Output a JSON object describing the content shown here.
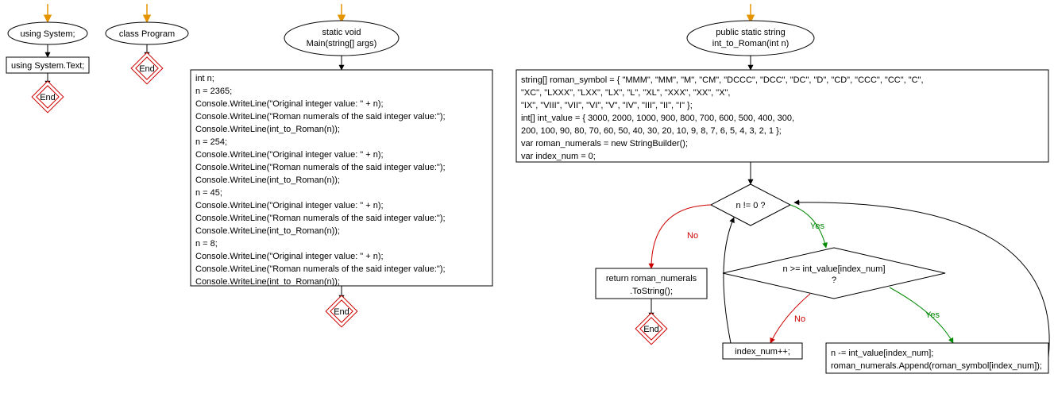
{
  "nodes": {
    "n1_ellipse": "using System;",
    "n1_rect": "using System.Text;",
    "n1_end": "End",
    "n2_ellipse": "class Program",
    "n2_end": "End",
    "n3_ellipse_l1": "static void",
    "n3_ellipse_l2": "Main(string[] args)",
    "n3_rect": [
      "int n;",
      "n = 2365;",
      "Console.WriteLine(\"Original integer value: \" + n);",
      "Console.WriteLine(\"Roman numerals of the said integer value:\");",
      "Console.WriteLine(int_to_Roman(n));",
      "n = 254;",
      "Console.WriteLine(\"Original integer value: \" + n);",
      "Console.WriteLine(\"Roman numerals of the said integer value:\");",
      "Console.WriteLine(int_to_Roman(n));",
      "n = 45;",
      "Console.WriteLine(\"Original integer value: \" + n);",
      "Console.WriteLine(\"Roman numerals of the said integer value:\");",
      "Console.WriteLine(int_to_Roman(n));",
      "n = 8;",
      "Console.WriteLine(\"Original integer value: \" + n);",
      "Console.WriteLine(\"Roman numerals of the said integer value:\");",
      "Console.WriteLine(int_to_Roman(n));"
    ],
    "n3_end": "End",
    "n4_ellipse_l1": "public static string",
    "n4_ellipse_l2": "int_to_Roman(int n)",
    "n4_rect": [
      "string[] roman_symbol = { \"MMM\", \"MM\", \"M\", \"CM\", \"DCCC\", \"DCC\", \"DC\", \"D\", \"CD\", \"CCC\", \"CC\", \"C\",",
      "\"XC\", \"LXXX\", \"LXX\", \"LX\", \"L\", \"XL\", \"XXX\", \"XX\", \"X\",",
      "\"IX\", \"VIII\", \"VII\", \"VI\", \"V\", \"IV\", \"III\", \"II\", \"I\" };",
      "int[] int_value = { 3000, 2000, 1000, 900, 800, 700, 600, 500, 400, 300,",
      "200, 100, 90, 80, 70, 60, 50, 40, 30, 20, 10, 9, 8, 7, 6, 5, 4, 3, 2, 1 };",
      "var roman_numerals = new StringBuilder();",
      "var index_num = 0;"
    ],
    "d1": "n != 0 ?",
    "d2_l1": "n >= int_value[index_num]",
    "d2_l2": "?",
    "ret_l1": "return roman_numerals",
    "ret_l2": ".ToString();",
    "ret_end": "End",
    "idx": "index_num++;",
    "assign_l1": "n -= int_value[index_num];",
    "assign_l2": "roman_numerals.Append(roman_symbol[index_num]);"
  },
  "labels": {
    "no": "No",
    "yes": "Yes"
  }
}
